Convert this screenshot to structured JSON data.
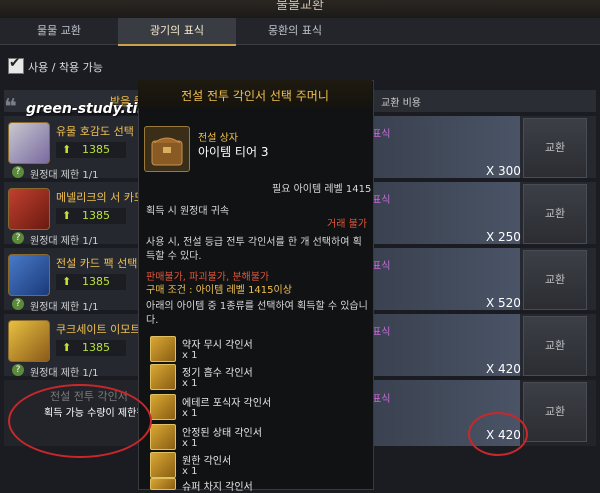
{
  "window": {
    "title": "물물교환"
  },
  "tabs": [
    {
      "label": "물물 교환"
    },
    {
      "label": "광기의 표식"
    },
    {
      "label": "몽환의 표식"
    }
  ],
  "filter": {
    "label": "사용 / 착용 가능",
    "checked": true
  },
  "list_header": {
    "left": "받을 물",
    "right": "교환 비용"
  },
  "watermark": "green-study.tistory.com",
  "rows": [
    {
      "name": "유물 호감도 선택",
      "cost": "1385",
      "limit": "원정대 제한 1/1",
      "price_label": "표식",
      "price": "X 300",
      "button": "교환"
    },
    {
      "name": "메넬리크의 서 카드",
      "cost": "1385",
      "limit": "원정대 제한 1/1",
      "price_label": "표식",
      "price": "X 250",
      "button": "교환"
    },
    {
      "name": "전설 카드 팩 선택",
      "cost": "1385",
      "limit": "원정대 제한 1/1",
      "price_label": "표식",
      "price": "X 520",
      "button": "교환"
    },
    {
      "name": "쿠크세이트 이모트",
      "cost": "1385",
      "limit": "원정대 제한 1/1",
      "price_label": "표식",
      "price": "X 420",
      "button": "교환"
    },
    {
      "name": "전설 전투 각인서",
      "cost": "",
      "limit": "",
      "price_label": "표식",
      "price": "X 420",
      "button": "교환",
      "tip": "획득 가능 수량이 제한됨"
    }
  ],
  "tooltip": {
    "title": "전설 전투 각인서 선택 주머니",
    "subtitle": "전설 상자",
    "tier": "아이템 티어 3",
    "req_level": "필요 아이템 레벨 1415",
    "bind": "획득 시 원정대 귀속",
    "trade": "거래 불가",
    "desc": "사용 시, 전설 등급 전투 각인서를 한 개 선택하여 획득할 수 있다.",
    "nosell": "판매불가, 파괴불가, 분해불가",
    "condition": "구매 조건 : 아이템 레벨 1415이상",
    "choose": "아래의 아이템 중 1종류를 선택하여 획득할 수 있습니다.",
    "items": [
      {
        "name": "약자 무시 각인서",
        "qty": "x 1"
      },
      {
        "name": "정기 흡수 각인서",
        "qty": "x 1"
      },
      {
        "name": "에테르 포식자 각인서",
        "qty": "x 1"
      },
      {
        "name": "안정된 상태 각인서",
        "qty": "x 1"
      },
      {
        "name": "원한 각인서",
        "qty": "x 1"
      },
      {
        "name": "슈퍼 차지 각인서",
        "qty": ""
      }
    ]
  },
  "colors": {
    "accent_gold": "#f0c050",
    "annotation_red": "#c8282a",
    "price_purple": "#c86ad8"
  }
}
